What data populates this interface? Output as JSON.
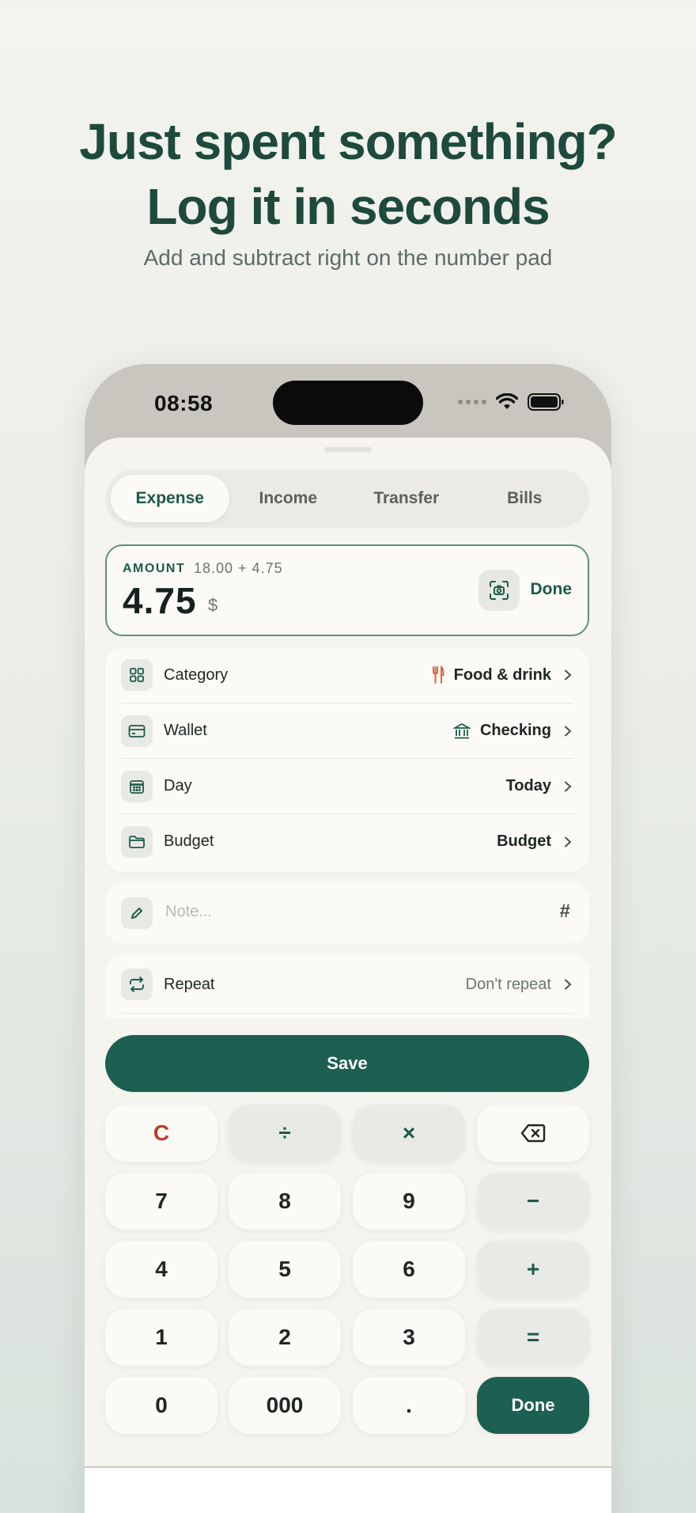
{
  "header": {
    "line1": "Just spent something?",
    "line2": "Log it in seconds",
    "subtitle": "Add and subtract right on the number pad"
  },
  "status_bar": {
    "time": "08:58"
  },
  "tabs": [
    {
      "label": "Expense",
      "active": true
    },
    {
      "label": "Income",
      "active": false
    },
    {
      "label": "Transfer",
      "active": false
    },
    {
      "label": "Bills",
      "active": false
    }
  ],
  "amount": {
    "label": "AMOUNT",
    "expression": "18.00 + 4.75",
    "value": "4.75",
    "currency": "$",
    "done_label": "Done"
  },
  "fields": {
    "category": {
      "label": "Category",
      "value": "Food & drink",
      "icon": "fork-knife-icon"
    },
    "wallet": {
      "label": "Wallet",
      "value": "Checking",
      "icon": "bank-icon"
    },
    "day": {
      "label": "Day",
      "value": "Today"
    },
    "budget": {
      "label": "Budget",
      "value": "Budget"
    }
  },
  "note": {
    "placeholder": "Note...",
    "tag_symbol": "#"
  },
  "repeat": {
    "label": "Repeat",
    "value": "Don't repeat"
  },
  "save_label": "Save",
  "keypad": {
    "row1": [
      "C",
      "÷",
      "×",
      "⌫"
    ],
    "row2": [
      "7",
      "8",
      "9",
      "−"
    ],
    "row3": [
      "4",
      "5",
      "6",
      "+"
    ],
    "row4": [
      "1",
      "2",
      "3",
      "="
    ],
    "row5": [
      "0",
      "000",
      ".",
      "Done"
    ]
  },
  "colors": {
    "accent": "#1d5f52",
    "headline": "#1d4a3c",
    "clear": "#b8402c",
    "category_icon": "#e0633f"
  }
}
